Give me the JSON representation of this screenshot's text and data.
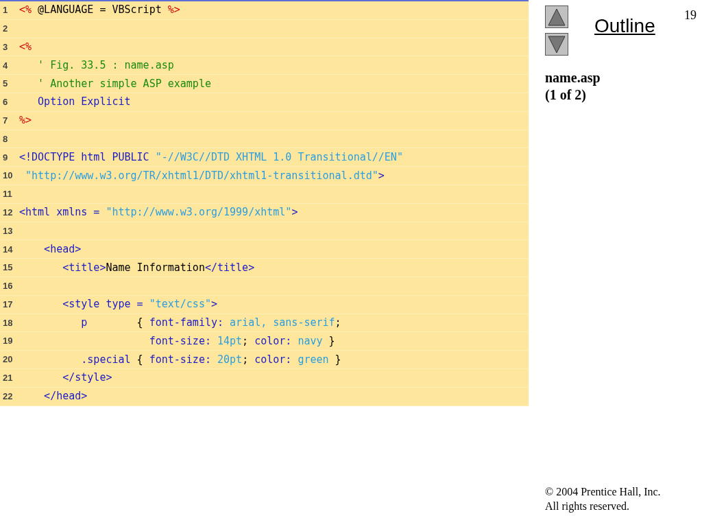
{
  "code": {
    "lines": [
      {
        "number": "1",
        "segments": [
          {
            "kind": "delimiter",
            "text": "<%"
          },
          {
            "kind": "text",
            "text": " @LANGUAGE = VBScript "
          },
          {
            "kind": "delimiter",
            "text": "%>"
          }
        ]
      },
      {
        "number": "2"
      },
      {
        "number": "3",
        "segments": [
          {
            "kind": "delimiter",
            "text": "<%"
          }
        ]
      },
      {
        "number": "4",
        "segments": [
          {
            "kind": "comment",
            "text": "   ' Fig. 33.5 : name.asp"
          }
        ]
      },
      {
        "number": "5",
        "segments": [
          {
            "kind": "comment",
            "text": "   ' Another simple ASP example"
          }
        ]
      },
      {
        "number": "6",
        "segments": [
          {
            "kind": "keyword",
            "text": "   Option Explicit"
          }
        ]
      },
      {
        "number": "7",
        "segments": [
          {
            "kind": "delimiter",
            "text": "%>"
          }
        ]
      },
      {
        "number": "8"
      },
      {
        "number": "9",
        "segments": [
          {
            "kind": "keyword",
            "text": "<!DOCTYPE html PUBLIC "
          },
          {
            "kind": "string",
            "text": "\"-//W3C//DTD XHTML 1.0 Transitional//EN\""
          }
        ]
      },
      {
        "number": "10",
        "segments": [
          {
            "kind": "string",
            "text": " \"http://www.w3.org/TR/xhtml1/DTD/xhtml1-transitional.dtd\""
          },
          {
            "kind": "keyword",
            "text": ">"
          }
        ]
      },
      {
        "number": "11"
      },
      {
        "number": "12",
        "segments": [
          {
            "kind": "keyword",
            "text": "<html xmlns = "
          },
          {
            "kind": "string",
            "text": "\"http://www.w3.org/1999/xhtml\""
          },
          {
            "kind": "keyword",
            "text": ">"
          }
        ]
      },
      {
        "number": "13"
      },
      {
        "number": "14",
        "segments": [
          {
            "kind": "keyword",
            "text": "    <head>"
          }
        ]
      },
      {
        "number": "15",
        "segments": [
          {
            "kind": "keyword",
            "text": "       <title>"
          },
          {
            "kind": "text",
            "text": "Name Information"
          },
          {
            "kind": "keyword",
            "text": "</title>"
          }
        ]
      },
      {
        "number": "16"
      },
      {
        "number": "17",
        "segments": [
          {
            "kind": "keyword",
            "text": "       <style type = "
          },
          {
            "kind": "string",
            "text": "\"text/css\""
          },
          {
            "kind": "keyword",
            "text": ">"
          }
        ]
      },
      {
        "number": "18",
        "segments": [
          {
            "kind": "keyword",
            "text": "          p"
          },
          {
            "kind": "text",
            "text": "        { "
          },
          {
            "kind": "keyword",
            "text": "font-family: "
          },
          {
            "kind": "string",
            "text": "arial, sans-serif"
          },
          {
            "kind": "text",
            "text": ";"
          }
        ]
      },
      {
        "number": "19",
        "segments": [
          {
            "kind": "keyword",
            "text": "                     font-size: "
          },
          {
            "kind": "string",
            "text": "14pt"
          },
          {
            "kind": "text",
            "text": "; "
          },
          {
            "kind": "keyword",
            "text": "color: "
          },
          {
            "kind": "string",
            "text": "navy"
          },
          {
            "kind": "text",
            "text": " }"
          }
        ]
      },
      {
        "number": "20",
        "segments": [
          {
            "kind": "keyword",
            "text": "          .special"
          },
          {
            "kind": "text",
            "text": " { "
          },
          {
            "kind": "keyword",
            "text": "font-size: "
          },
          {
            "kind": "string",
            "text": "20pt"
          },
          {
            "kind": "text",
            "text": "; "
          },
          {
            "kind": "keyword",
            "text": "color: "
          },
          {
            "kind": "string",
            "text": "green"
          },
          {
            "kind": "text",
            "text": " }"
          }
        ]
      },
      {
        "number": "21",
        "segments": [
          {
            "kind": "keyword",
            "text": "       </style>"
          }
        ]
      },
      {
        "number": "22",
        "segments": [
          {
            "kind": "keyword",
            "text": "    </head>"
          }
        ]
      }
    ]
  },
  "sidebar": {
    "slide_number": "19",
    "heading": "Outline",
    "file": "name.asp",
    "part": "(1 of 2)"
  },
  "footer": {
    "copyright": "© 2004 Prentice Hall, Inc.",
    "rights": "All rights reserved."
  }
}
